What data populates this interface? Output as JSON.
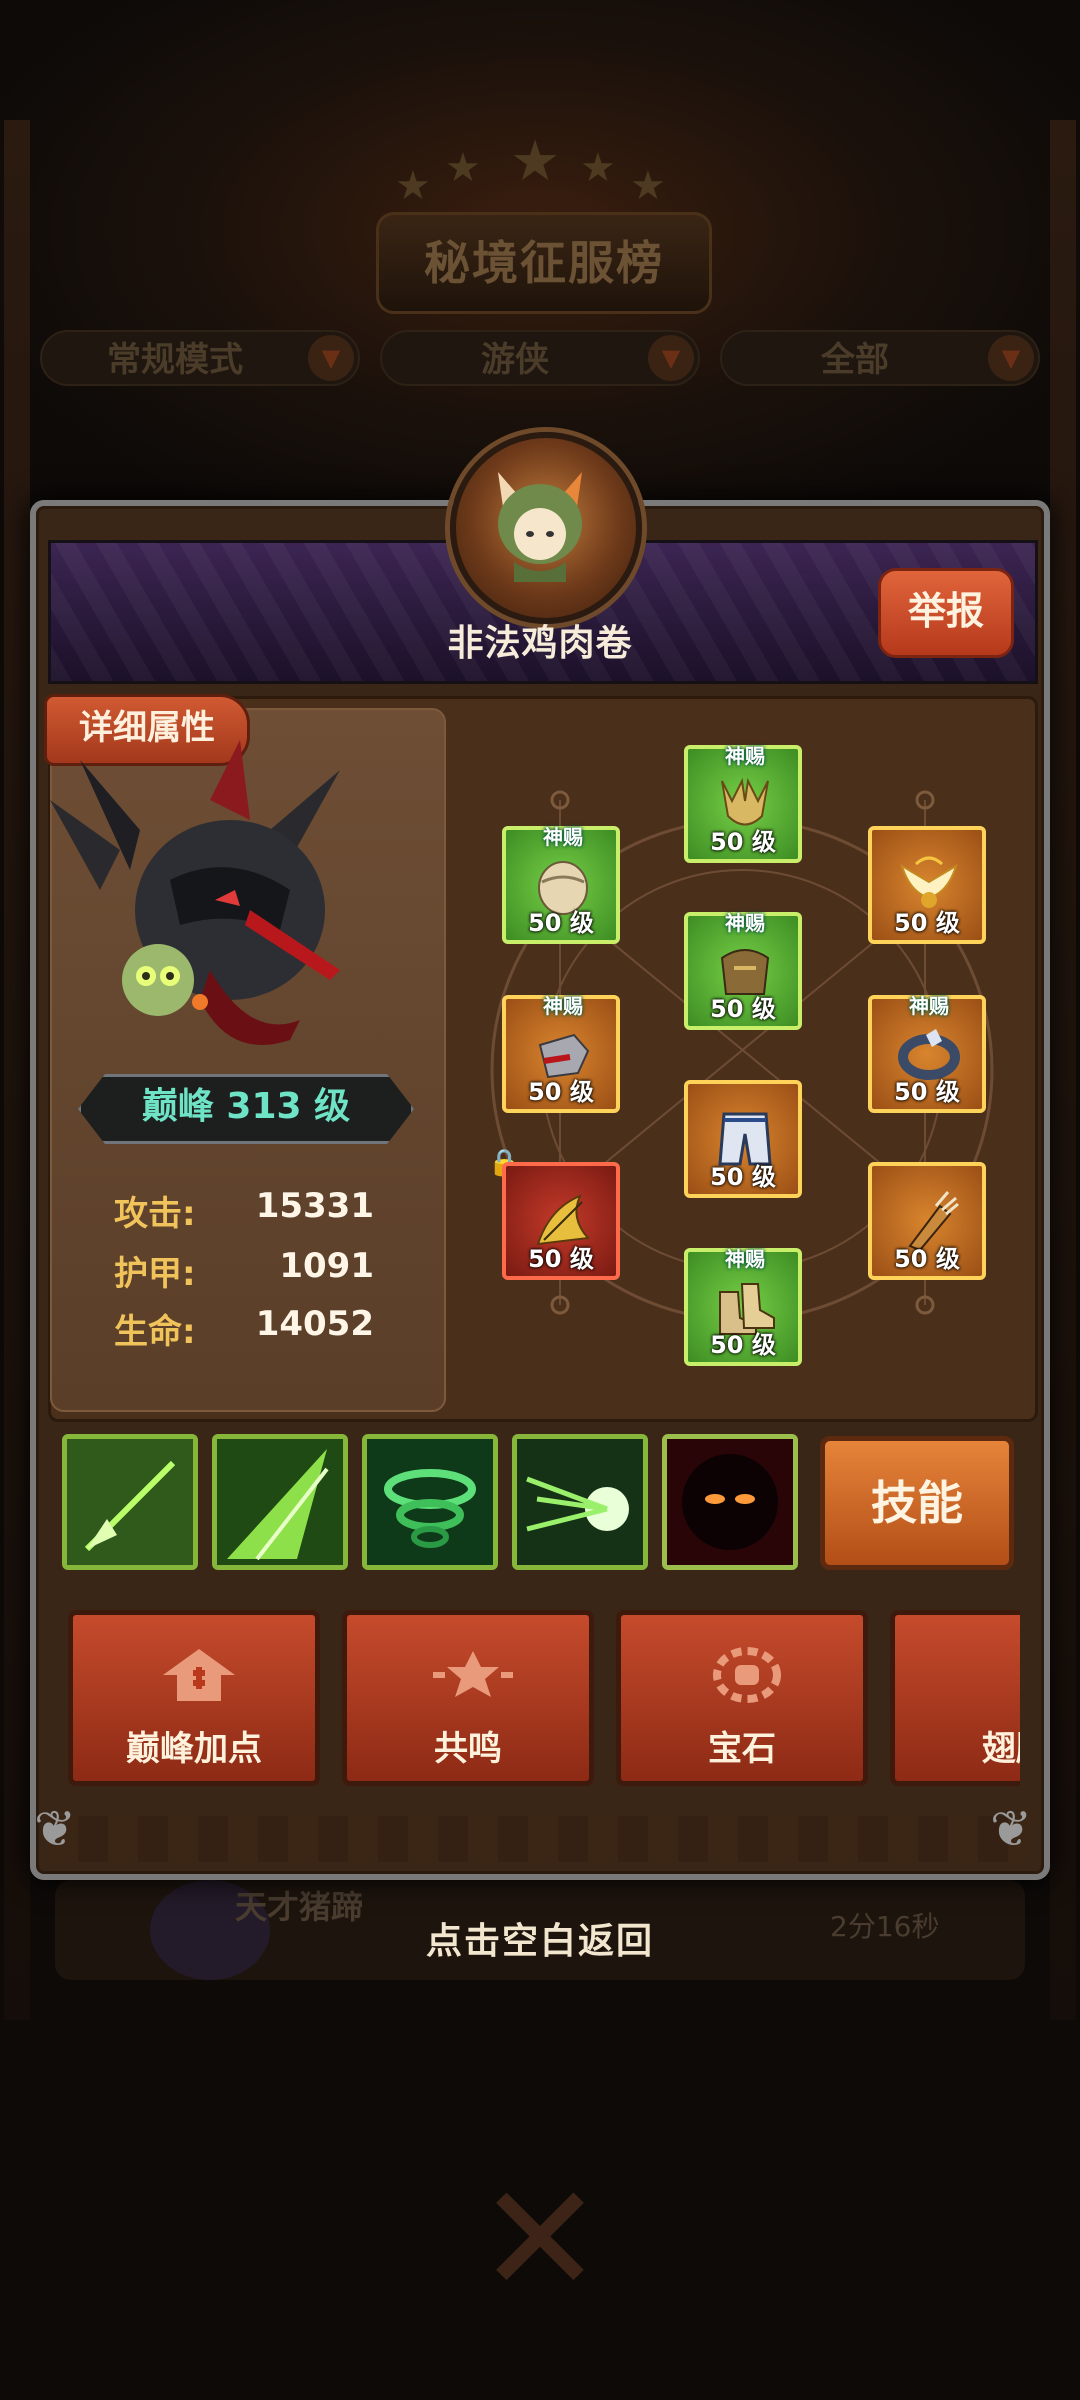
{
  "header": {
    "title": "秘境征服榜",
    "filters": [
      {
        "label": "常规模式"
      },
      {
        "label": "游侠"
      },
      {
        "label": "全部"
      }
    ]
  },
  "player": {
    "name": "非法鸡肉卷",
    "report_label": "举报",
    "detail_tag": "详细属性",
    "level_text": "巅峰 313 级",
    "stats": [
      {
        "label": "攻击:",
        "value": "15331"
      },
      {
        "label": "护甲:",
        "value": "1091"
      },
      {
        "label": "生命:",
        "value": "14052"
      }
    ]
  },
  "equipment": [
    {
      "slot": "helmet",
      "badge": "神赐",
      "level": "50 级",
      "rarity": "green",
      "icon": "antler-helmet-icon"
    },
    {
      "slot": "armor",
      "badge": "神赐",
      "level": "50 级",
      "rarity": "green",
      "icon": "shoulder-armor-icon"
    },
    {
      "slot": "amulet",
      "badge": "",
      "level": "50 级",
      "rarity": "orange",
      "icon": "winged-amulet-icon"
    },
    {
      "slot": "chest",
      "badge": "神赐",
      "level": "50 级",
      "rarity": "green",
      "icon": "chest-armor-icon"
    },
    {
      "slot": "gloves",
      "badge": "神赐",
      "level": "50 级",
      "rarity": "orange",
      "icon": "gauntlet-icon"
    },
    {
      "slot": "ring",
      "badge": "神赐",
      "level": "50 级",
      "rarity": "orange",
      "icon": "ring-icon"
    },
    {
      "slot": "pants",
      "badge": "",
      "level": "50 级",
      "rarity": "orange",
      "icon": "pants-icon"
    },
    {
      "slot": "weapon",
      "badge": "",
      "level": "50 级",
      "rarity": "red",
      "icon": "bow-icon"
    },
    {
      "slot": "quiver",
      "badge": "",
      "level": "50 级",
      "rarity": "orange",
      "icon": "quiver-icon"
    },
    {
      "slot": "boots",
      "badge": "神赐",
      "level": "50 级",
      "rarity": "green",
      "icon": "boots-icon"
    }
  ],
  "skills": {
    "icons": [
      "spear-skill-icon",
      "arrow-rain-skill-icon",
      "whirlwind-skill-icon",
      "burst-shot-skill-icon",
      "shadow-demon-skill-icon"
    ],
    "button_label": "技能"
  },
  "functions": [
    {
      "label": "巅峰加点",
      "icon": "peak-points-icon"
    },
    {
      "label": "共鸣",
      "icon": "resonance-icon"
    },
    {
      "label": "宝石",
      "icon": "gem-icon"
    },
    {
      "label": "翅膀",
      "icon": "wings-icon"
    }
  ],
  "background_row": {
    "name": "天才猪蹄",
    "time": "2分16秒"
  },
  "hint": "点击空白返回"
}
